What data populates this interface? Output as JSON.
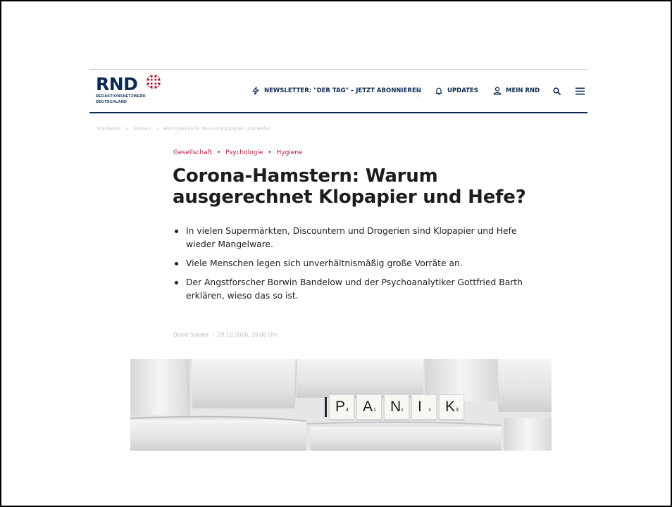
{
  "header": {
    "logo_text": "RND",
    "logo_sub_line1": "REDAKTIONSNETZWERK",
    "logo_sub_line2": "DEUTSCHLAND",
    "newsletter_label": "NEWSLETTER: \"DER TAG\" – JETZT ABONNIEREN",
    "updates_label": "UPDATES",
    "mein_rnd_label": "MEIN RND",
    "icons": [
      "lightning-icon",
      "bell-icon",
      "user-icon",
      "search-icon",
      "menu-icon"
    ]
  },
  "breadcrumb": [
    "Startseite",
    "Wissen",
    "Hamsterkäufe: Warum Klopapier und Hefe?"
  ],
  "breadcrumb_separator": ">",
  "article": {
    "tags": [
      "Gesellschaft",
      "Psychologie",
      "Hygiene"
    ],
    "tag_separator": "•",
    "title_line1": "Corona-Hamstern: Warum",
    "title_line2": "ausgerechnet Klopapier und Hefe?",
    "bullets": [
      "In vielen Supermärkten, Discountern und Drogerien sind Klopapier und Hefe wieder Mangelware.",
      "Viele Menschen legen sich unverhältnismäßig große Vorräte an.",
      "Der Angstforscher Borwin Bandelow und der Psychoanalytiker Gottfried Barth erklären, wieso das so ist."
    ],
    "author": "David Sander",
    "date": "29.10.2020, 19:00 Uhr"
  },
  "hero": {
    "tiles": [
      {
        "letter": "P",
        "score": "4"
      },
      {
        "letter": "A",
        "score": "1"
      },
      {
        "letter": "N",
        "score": "1"
      },
      {
        "letter": "I",
        "score": "1"
      },
      {
        "letter": "K",
        "score": "3"
      }
    ]
  },
  "colors": {
    "brand": "#0d2a52",
    "accent": "#b01c39",
    "text": "#1d1d1f"
  }
}
